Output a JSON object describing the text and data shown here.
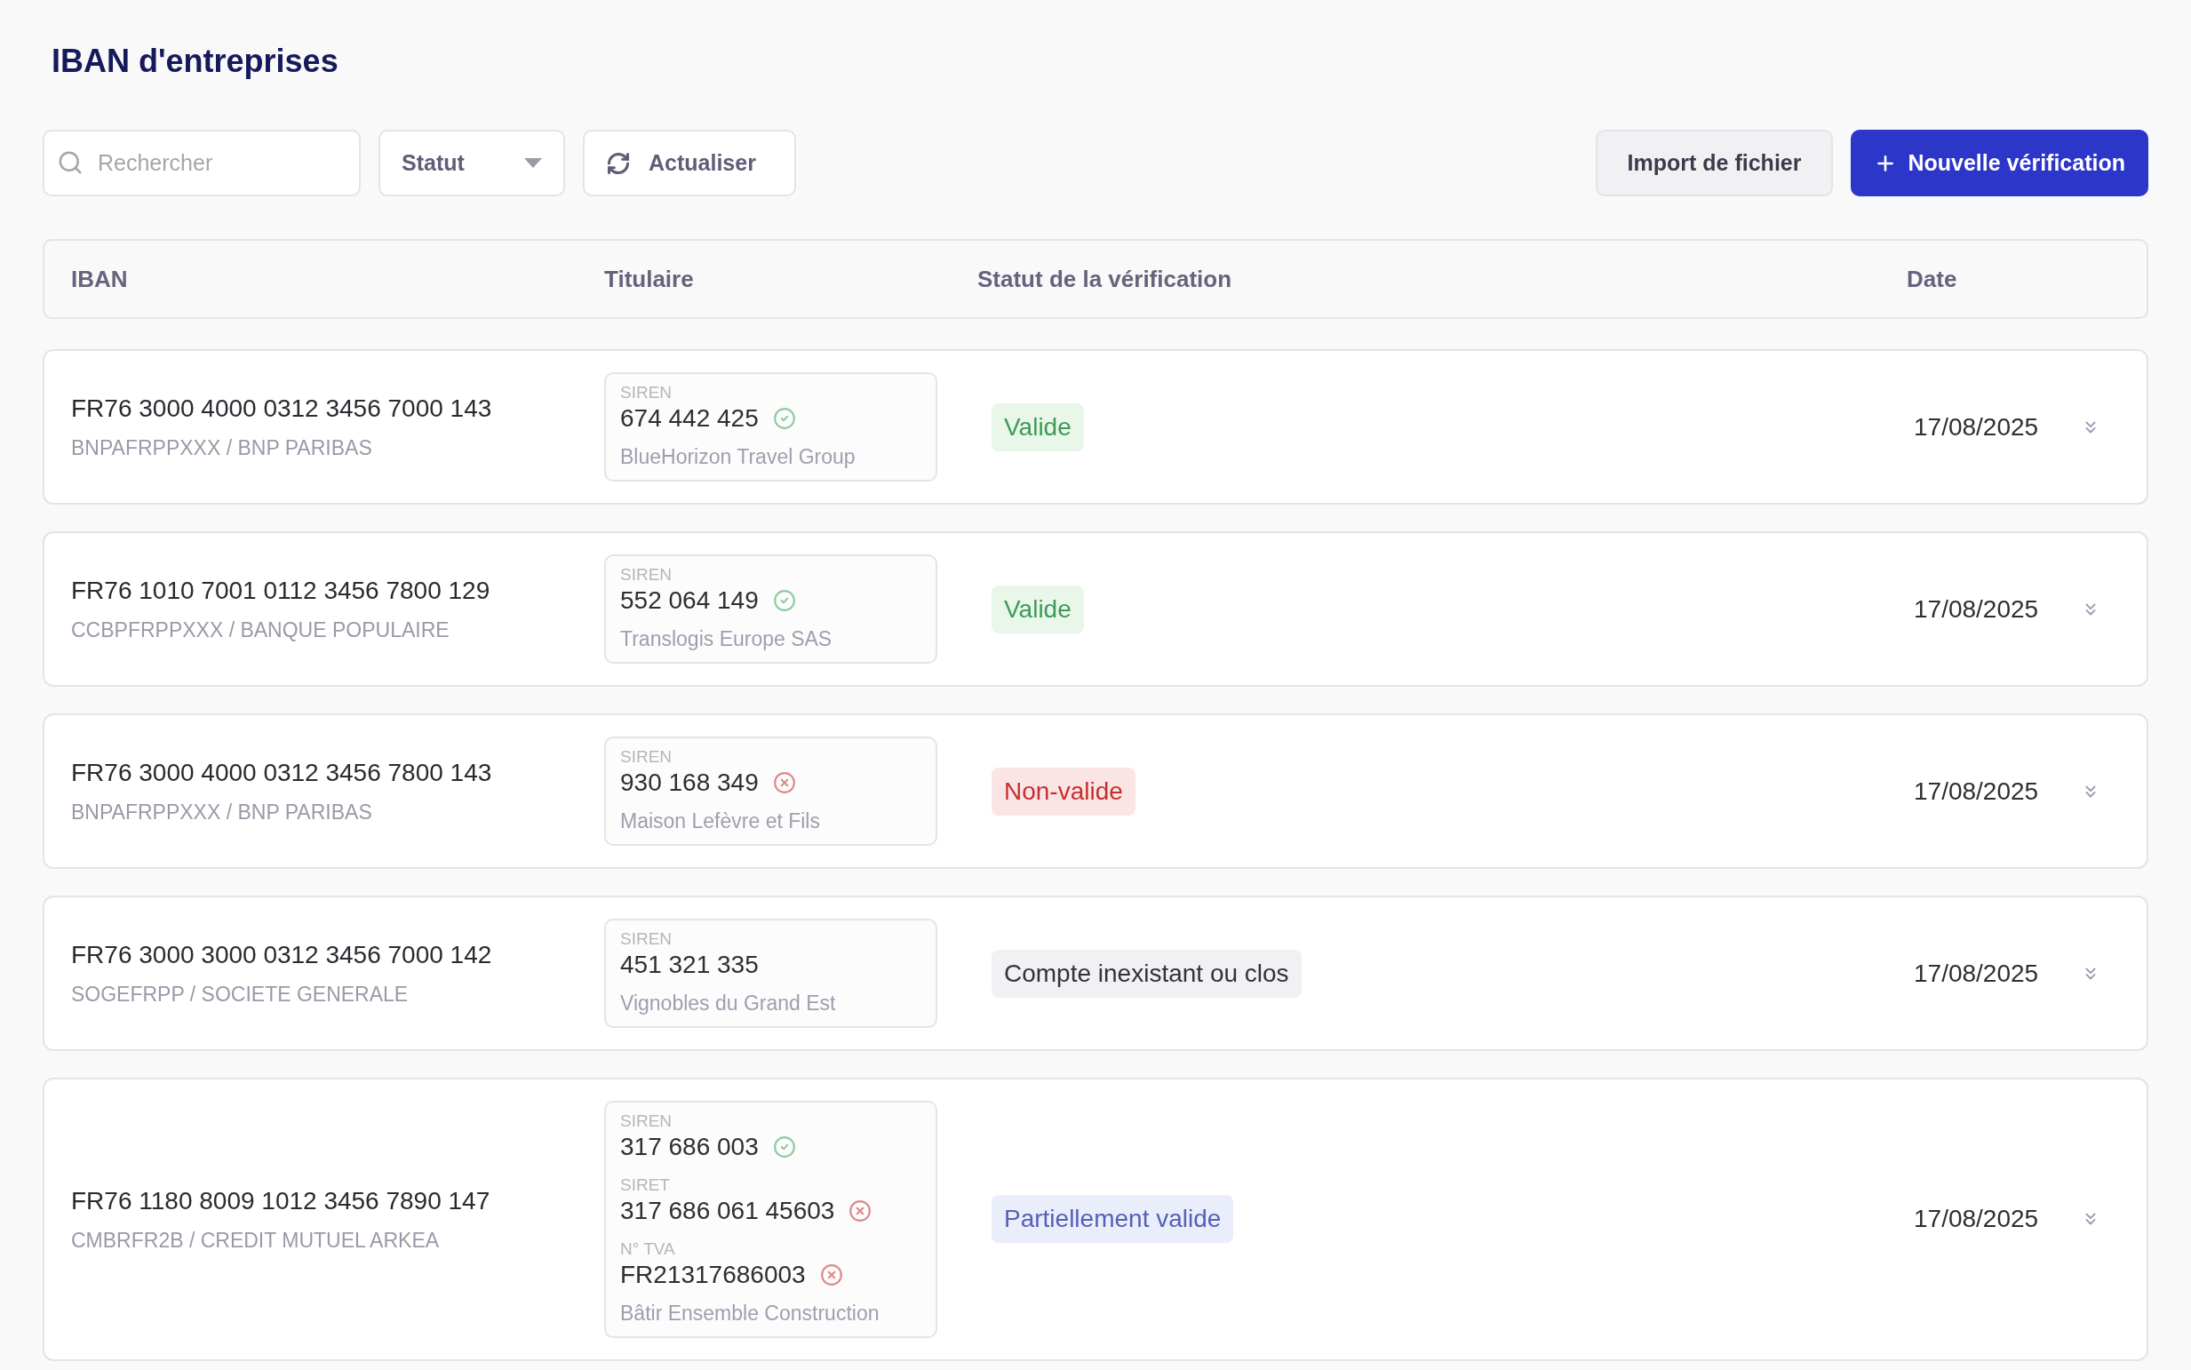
{
  "title": "IBAN d'entreprises",
  "toolbar": {
    "search": {
      "placeholder": "Rechercher"
    },
    "status_filter": {
      "label": "Statut"
    },
    "refresh": {
      "label": "Actualiser"
    },
    "import": {
      "label": "Import de fichier"
    },
    "new": {
      "label": "Nouvelle vérification"
    }
  },
  "table": {
    "columns": [
      "IBAN",
      "Titulaire",
      "Statut de la vérification",
      "Date"
    ],
    "rows": [
      {
        "iban": "FR76 3000 4000 0312 3456 7000 143",
        "bank": "BNPAFRPPXXX / BNP PARIBAS",
        "ids": [
          {
            "label": "SIREN",
            "value": "674 442 425",
            "verified": true
          }
        ],
        "holder": "BlueHorizon Travel Group",
        "status": {
          "label": "Valide",
          "kind": "valid"
        },
        "date": "17/08/2025"
      },
      {
        "iban": "FR76 1010 7001 0112 3456 7800 129",
        "bank": "CCBPFRPPXXX / BANQUE POPULAIRE",
        "ids": [
          {
            "label": "SIREN",
            "value": "552 064 149",
            "verified": true
          }
        ],
        "holder": "Translogis Europe SAS",
        "status": {
          "label": "Valide",
          "kind": "valid"
        },
        "date": "17/08/2025"
      },
      {
        "iban": "FR76 3000 4000 0312 3456 7800 143",
        "bank": "BNPAFRPPXXX / BNP PARIBAS",
        "ids": [
          {
            "label": "SIREN",
            "value": "930 168 349",
            "verified": false
          }
        ],
        "holder": "Maison Lefèvre et Fils",
        "status": {
          "label": "Non-valide",
          "kind": "invalid"
        },
        "date": "17/08/2025"
      },
      {
        "iban": "FR76 3000 3000 0312 3456 7000 142",
        "bank": "SOGEFRPP / SOCIETE GENERALE",
        "ids": [
          {
            "label": "SIREN",
            "value": "451 321 335"
          }
        ],
        "holder": "Vignobles du Grand Est",
        "status": {
          "label": "Compte inexistant ou clos",
          "kind": "neutral"
        },
        "date": "17/08/2025"
      },
      {
        "iban": "FR76 1180 8009 1012 3456 7890 147",
        "bank": "CMBRFR2B / CREDIT MUTUEL ARKEA",
        "ids": [
          {
            "label": "SIREN",
            "value": "317 686 003",
            "verified": true
          },
          {
            "label": "SIRET",
            "value": "317 686 061 45603",
            "verified": false
          },
          {
            "label": "N° TVA",
            "value": "FR21317686003",
            "verified": false
          }
        ],
        "holder": "Bâtir Ensemble Construction",
        "status": {
          "label": "Partiellement valide",
          "kind": "partial"
        },
        "date": "17/08/2025"
      }
    ]
  }
}
